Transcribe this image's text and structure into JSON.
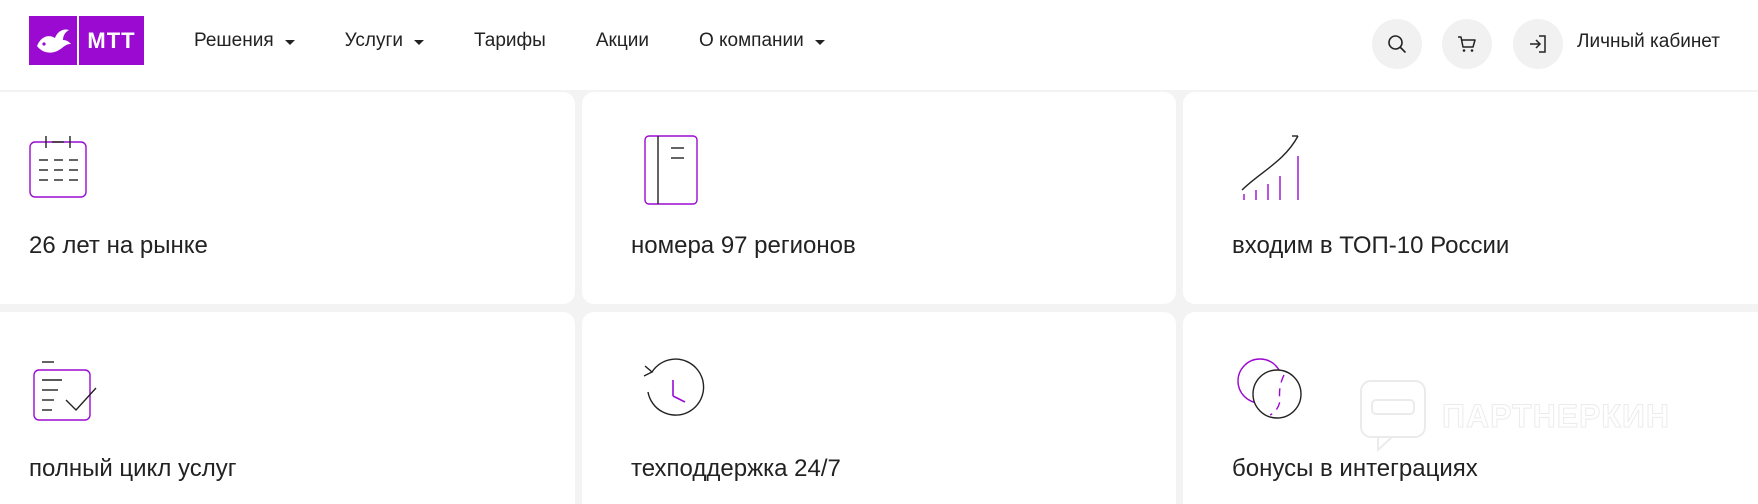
{
  "header": {
    "logo_text": "МТТ",
    "nav": [
      {
        "label": "Решения",
        "has_caret": true
      },
      {
        "label": "Услуги",
        "has_caret": true
      },
      {
        "label": "Тарифы",
        "has_caret": false
      },
      {
        "label": "Акции",
        "has_caret": false
      },
      {
        "label": "О компании",
        "has_caret": true
      }
    ],
    "account_label": "Личный кабинет",
    "icons": [
      "search-icon",
      "cart-icon",
      "login-icon"
    ]
  },
  "cards": [
    {
      "label": "26 лет на рынке",
      "icon": "calendar-icon"
    },
    {
      "label": "номера 97 регионов",
      "icon": "notebook-icon"
    },
    {
      "label": "входим в ТОП-10 России",
      "icon": "growth-chart-icon"
    },
    {
      "label": "полный цикл услуг",
      "icon": "checklist-icon"
    },
    {
      "label": "техподдержка 24/7",
      "icon": "clock-icon"
    },
    {
      "label": "бонусы в интеграциях",
      "icon": "coins-icon"
    }
  ],
  "watermark": "ПАРТНЕРКИН",
  "colors": {
    "accent": "#9b0ad0",
    "background": "#f3f3f3",
    "card": "#ffffff",
    "text": "#222222"
  }
}
